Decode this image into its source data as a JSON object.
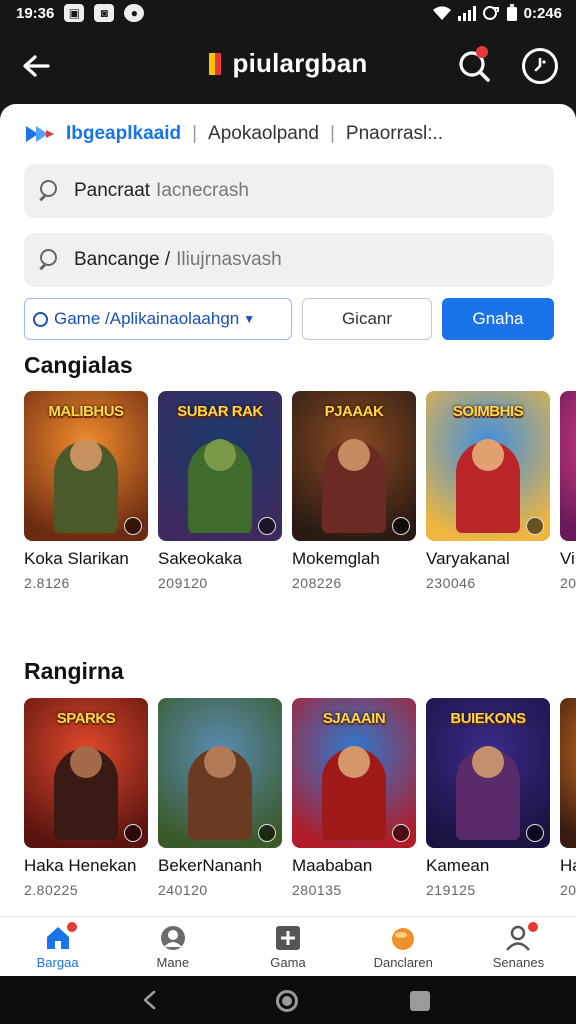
{
  "status_bar": {
    "time": "19:36",
    "right_time": "0:246"
  },
  "app_bar": {
    "title": "piulargban"
  },
  "breadcrumb": {
    "brand": "Ibgeaplkaaid",
    "item2": "Apokaolpand",
    "item3": "Pnaorrasl:.."
  },
  "search1": {
    "label": "Pancraat",
    "hint": "Iacnecrash"
  },
  "search2": {
    "label": "Bancange /",
    "hint": "Iliujrnasvash"
  },
  "filters": {
    "dropdown_label": "Game /Aplikainaolaahgn",
    "clear_label": "Gicanr",
    "primary_label": "Gnaha"
  },
  "sections": [
    {
      "title": "Cangialas",
      "items": [
        {
          "name": "Koka Slarikan",
          "sub": "2.8126",
          "art_text": "MALIBHUS",
          "bg": [
            "#f28c2e",
            "#6b2a12"
          ],
          "fig": "#4b5a2a",
          "head": "#c9905f"
        },
        {
          "name": "Sakeokaka",
          "sub": "209120",
          "art_text": "SUBAR RAK",
          "bg": [
            "#1c3a6b",
            "#3e2a5e"
          ],
          "fig": "#3f6b2d",
          "head": "#7a9a4a"
        },
        {
          "name": "Mokemglah",
          "sub": "208226",
          "art_text": "PJAAAK",
          "bg": [
            "#8a4a22",
            "#2a1a14"
          ],
          "fig": "#6b2a22",
          "head": "#c68a60"
        },
        {
          "name": "Varyakanal",
          "sub": "230046",
          "art_text": "SOIMBHIS",
          "bg": [
            "#3f8ee0",
            "#f0b640"
          ],
          "fig": "#b8262a",
          "head": "#e0a070"
        },
        {
          "name": "Vi",
          "sub": "20",
          "art_text": "",
          "bg": [
            "#ea3f8a",
            "#6a1a5a"
          ],
          "fig": "#9a2a7a",
          "head": "#e3a27a"
        }
      ]
    },
    {
      "title": "Rangirna",
      "items": [
        {
          "name": "Haka Henekan",
          "sub": "2.80225",
          "art_text": "SPARKS",
          "bg": [
            "#e0482a",
            "#5a1410"
          ],
          "fig": "#3a1a14",
          "head": "#a56a4a"
        },
        {
          "name": "BekerNananh",
          "sub": "240120",
          "art_text": "",
          "bg": [
            "#5a8ab0",
            "#3a5a2a"
          ],
          "fig": "#6a3a22",
          "head": "#b07a55"
        },
        {
          "name": "Maababan",
          "sub": "280135",
          "art_text": "SJAAAIN",
          "bg": [
            "#2d7ad0",
            "#b01c2a"
          ],
          "fig": "#a01a1a",
          "head": "#d5976a"
        },
        {
          "name": "Kamean",
          "sub": "219125",
          "art_text": "BUIEKONS",
          "bg": [
            "#3a2a8a",
            "#1a1240"
          ],
          "fig": "#5a2a6a",
          "head": "#c2906a"
        },
        {
          "name": "Ha",
          "sub": "20",
          "art_text": "",
          "bg": [
            "#e07a20",
            "#3a1a10"
          ],
          "fig": "#5a2a14",
          "head": "#b07a55"
        }
      ]
    }
  ],
  "bottom_nav": [
    {
      "label": "Bargaa",
      "icon": "home-icon",
      "active": true,
      "dot": true
    },
    {
      "label": "Mane",
      "icon": "avatar-icon",
      "active": false,
      "dot": false
    },
    {
      "label": "Gama",
      "icon": "gamepad-icon",
      "active": false,
      "dot": false
    },
    {
      "label": "Danclaren",
      "icon": "coin-icon",
      "active": false,
      "dot": false
    },
    {
      "label": "Senanes",
      "icon": "person-icon",
      "active": false,
      "dot": true
    }
  ],
  "colors": {
    "accent": "#1a73e8",
    "notif": "#e53935",
    "dark_bg": "#161616"
  }
}
